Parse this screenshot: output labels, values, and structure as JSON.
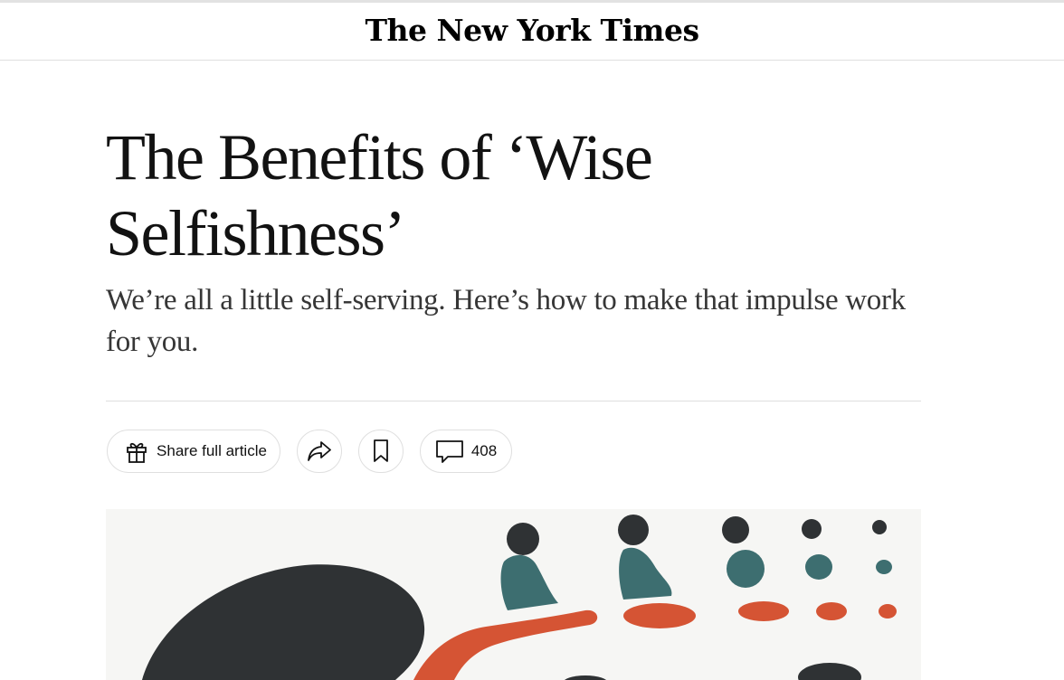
{
  "masthead": {
    "logo_text": "The New York Times"
  },
  "article": {
    "headline": "The Benefits of ‘Wise Selfishness’",
    "summary": "We’re all a little self-serving. Here’s how to make that impulse work for you."
  },
  "toolbar": {
    "share_full_label": "Share full article",
    "share_icon": "share-arrow-icon",
    "save_icon": "bookmark-icon",
    "comments_count": "408",
    "comments_icon": "comment-bubble-icon",
    "gift_icon": "gift-icon"
  },
  "illustration": {
    "colors": {
      "dark": "#2f3234",
      "teal": "#3d6e70",
      "orange": "#d55434",
      "background": "#f6f6f4"
    }
  }
}
